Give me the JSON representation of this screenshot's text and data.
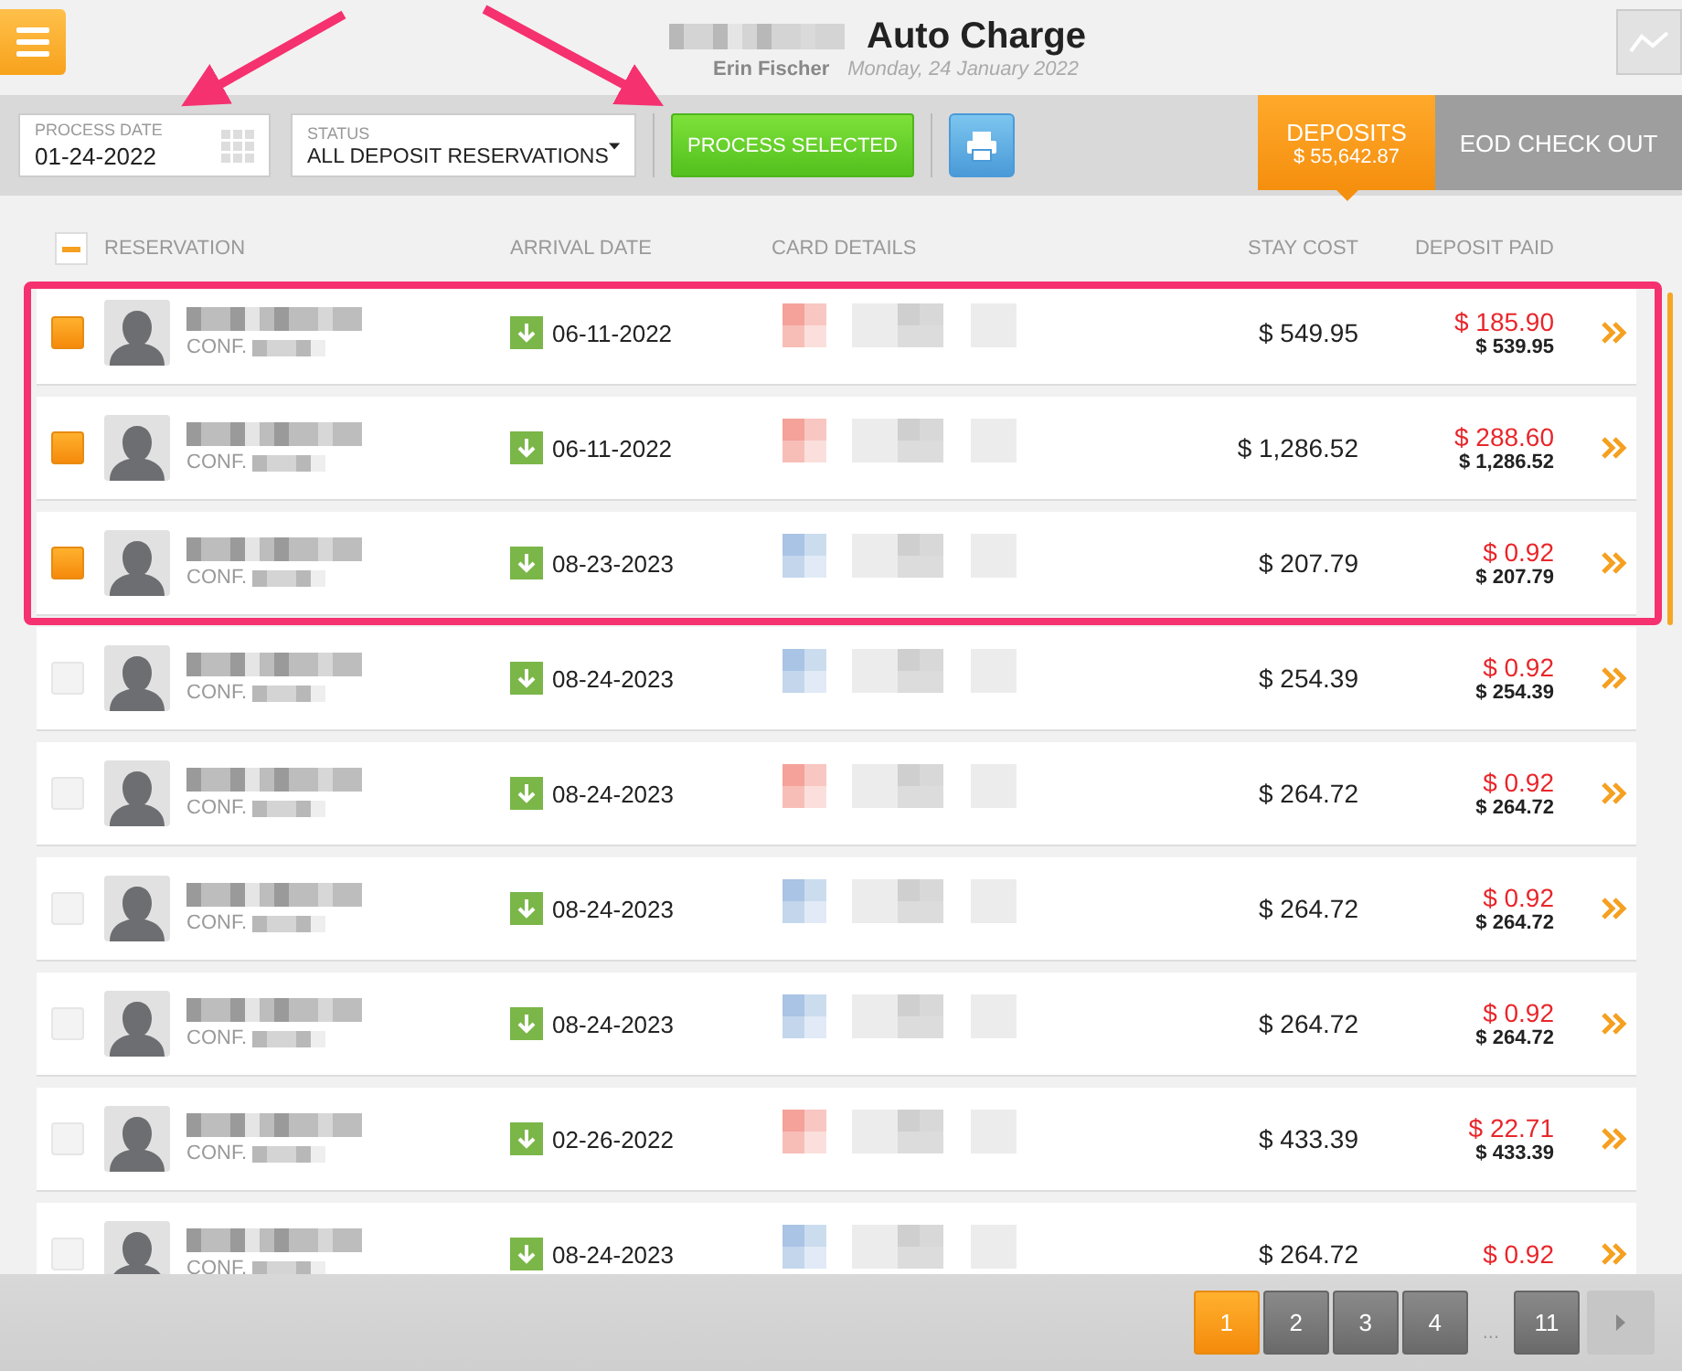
{
  "header": {
    "title": "Auto Charge",
    "user": "Erin Fischer",
    "date": "Monday, 24 January 2022"
  },
  "toolbar": {
    "process_date": {
      "label": "PROCESS DATE",
      "value": "01-24-2022"
    },
    "status": {
      "label": "STATUS",
      "value": "ALL DEPOSIT RESERVATIONS"
    },
    "process_button": "PROCESS SELECTED"
  },
  "tabs": [
    {
      "label": "DEPOSITS",
      "sub": "$ 55,642.87",
      "selected": true
    },
    {
      "label": "EOD CHECK OUT",
      "selected": false
    }
  ],
  "table": {
    "select_all": {
      "indeterminate": true
    },
    "columns": [
      "RESERVATION",
      "ARRIVAL DATE",
      "CARD DETAILS",
      "STAY COST",
      "DEPOSIT PAID"
    ],
    "rows": [
      {
        "selected": true,
        "conf": "CONF.",
        "arrival": "06-11-2022",
        "color": "#f4a29a",
        "stay_cost": "$ 549.95",
        "deposit": "$ 185.90",
        "deposit_total": "$ 539.95"
      },
      {
        "selected": true,
        "conf": "CONF.",
        "arrival": "06-11-2022",
        "color": "#f4a29a",
        "stay_cost": "$ 1,286.52",
        "deposit": "$ 288.60",
        "deposit_total": "$ 1,286.52"
      },
      {
        "selected": true,
        "conf": "CONF.",
        "arrival": "08-23-2023",
        "color": "#a9c4e4",
        "stay_cost": "$ 207.79",
        "deposit": "$ 0.92",
        "deposit_total": "$ 207.79"
      },
      {
        "selected": false,
        "conf": "CONF.",
        "arrival": "08-24-2023",
        "color": "#a9c4e4",
        "stay_cost": "$ 254.39",
        "deposit": "$ 0.92",
        "deposit_total": "$ 254.39"
      },
      {
        "selected": false,
        "conf": "CONF.",
        "arrival": "08-24-2023",
        "color": "#f4a29a",
        "stay_cost": "$ 264.72",
        "deposit": "$ 0.92",
        "deposit_total": "$ 264.72"
      },
      {
        "selected": false,
        "conf": "CONF.",
        "arrival": "08-24-2023",
        "color": "#a9c4e4",
        "stay_cost": "$ 264.72",
        "deposit": "$ 0.92",
        "deposit_total": "$ 264.72"
      },
      {
        "selected": false,
        "conf": "CONF.",
        "arrival": "08-24-2023",
        "color": "#a9c4e4",
        "stay_cost": "$ 264.72",
        "deposit": "$ 0.92",
        "deposit_total": "$ 264.72"
      },
      {
        "selected": false,
        "conf": "CONF.",
        "arrival": "02-26-2022",
        "color": "#f4a29a",
        "stay_cost": "$ 433.39",
        "deposit": "$ 22.71",
        "deposit_total": "$ 433.39"
      },
      {
        "selected": false,
        "conf": "CONF.",
        "arrival": "08-24-2023",
        "color": "#a9c4e4",
        "stay_cost": "$ 264.72",
        "deposit": "$ 0.92"
      }
    ]
  },
  "pagination": {
    "pages": [
      {
        "label": "1",
        "selected": true
      },
      {
        "label": "2",
        "selected": false
      },
      {
        "label": "3",
        "selected": false
      },
      {
        "label": "4",
        "selected": false
      },
      {
        "label": "11",
        "selected": false
      }
    ],
    "ellipsis": "..."
  }
}
